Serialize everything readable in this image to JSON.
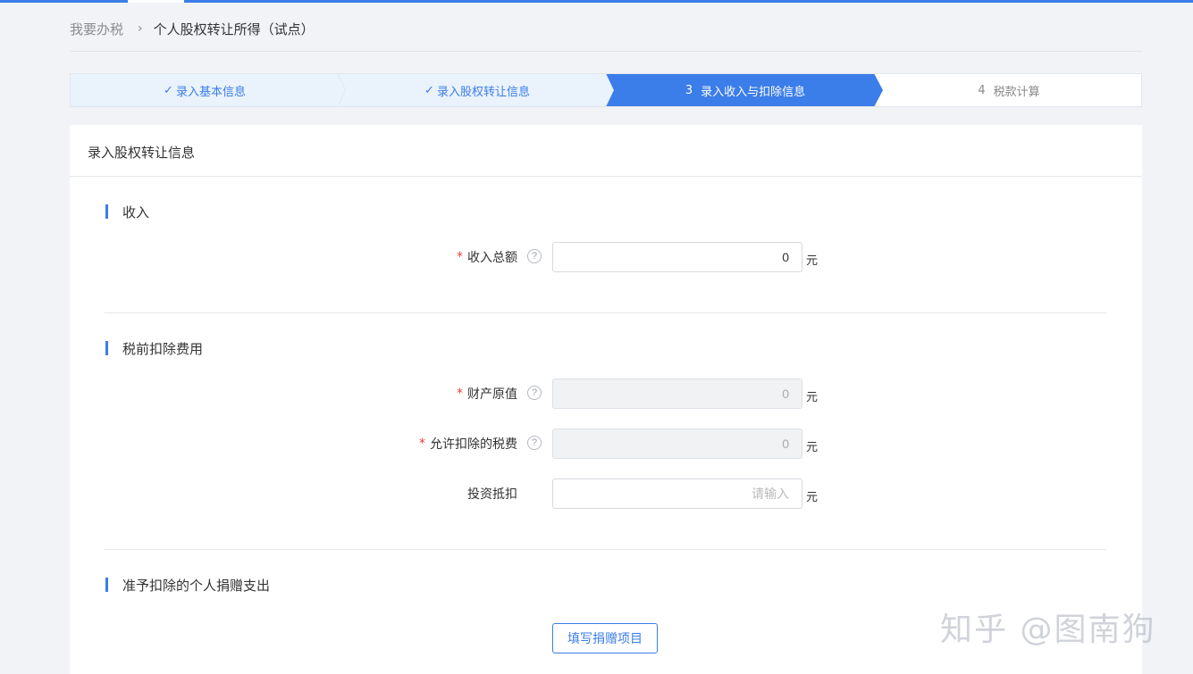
{
  "breadcrumb": {
    "home": "我要办税",
    "separator": "›",
    "current": "个人股权转让所得（试点）"
  },
  "steps": [
    {
      "label": "录入基本信息",
      "status": "done"
    },
    {
      "label": "录入股权转让信息",
      "status": "done"
    },
    {
      "number": "3",
      "label": "录入收入与扣除信息",
      "status": "active"
    },
    {
      "number": "4",
      "label": "税款计算",
      "status": "todo"
    }
  ],
  "colors": {
    "accent": "#3b7de9",
    "step_done_bg": "#eaf2fb",
    "required": "#e0413b"
  },
  "panel": {
    "title": "录入股权转让信息"
  },
  "income": {
    "title": "收入",
    "total_label": "收入总额",
    "total_value": "0",
    "unit": "元"
  },
  "deduction": {
    "title": "税前扣除费用",
    "original_value_label": "财产原值",
    "original_value": "0",
    "tax_fee_label": "允许扣除的税费",
    "tax_fee_value": "0",
    "investment_label": "投资抵扣",
    "investment_placeholder": "请输入",
    "unit": "元"
  },
  "donation": {
    "title": "准予扣除的个人捐赠支出",
    "button_label": "填写捐赠项目"
  },
  "help_glyph": "?",
  "required_mark": "*",
  "check_glyph": "✓",
  "watermark": "知乎 @图南狗"
}
